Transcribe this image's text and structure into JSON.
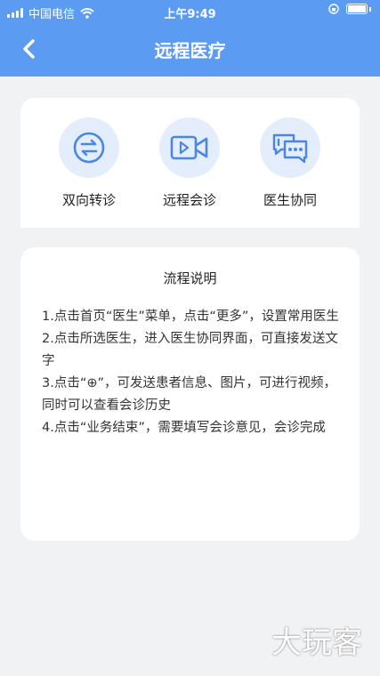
{
  "status_bar": {
    "carrier": "中国电信",
    "time": "上午9:49"
  },
  "header": {
    "title": "远程医疗",
    "back_icon": "chevron-left-icon"
  },
  "actions": [
    {
      "label": "双向转诊",
      "icon": "transfer-arrows-icon"
    },
    {
      "label": "远程会诊",
      "icon": "video-camera-icon"
    },
    {
      "label": "医生协同",
      "icon": "chat-bubbles-icon"
    }
  ],
  "instructions": {
    "title": "流程说明",
    "steps": [
      "1.点击首页“医生”菜单，点击“更多”，设置常用医生",
      "2.点击所选医生，进入医生协同界面，可直接发送文字",
      "3.点击“⊕”，可发送患者信息、图片，可进行视频，同时可以查看会诊历史",
      "4.点击“业务结束”，需要填写会诊意见，会诊完成"
    ]
  },
  "watermark": "大玩客",
  "colors": {
    "header_bg": "#5b9bf1",
    "icon_bg": "#e4edfb",
    "icon_stroke": "#4a86e8",
    "page_bg": "#f1f2f4"
  }
}
